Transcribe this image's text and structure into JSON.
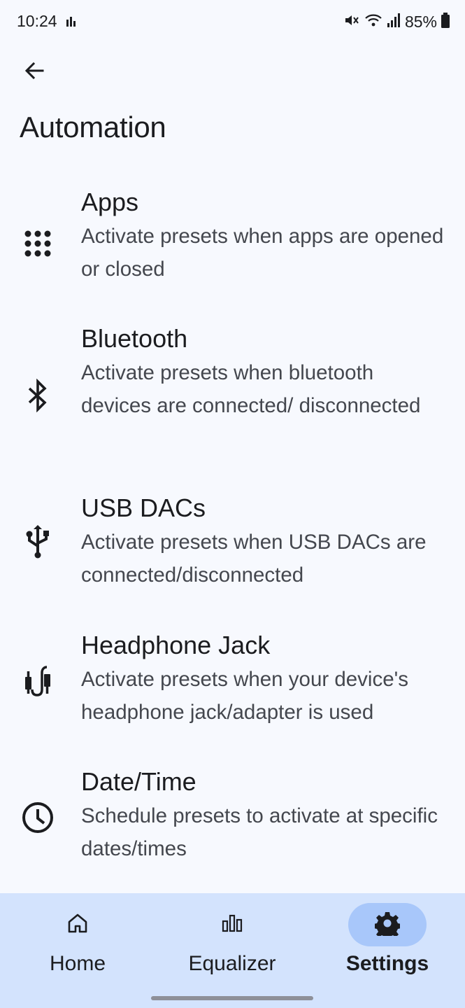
{
  "status_bar": {
    "time": "10:24",
    "battery_percent": "85%",
    "icons": [
      "activity-icon",
      "mute-icon",
      "wifi-icon",
      "signal-icon",
      "battery-icon"
    ]
  },
  "header": {
    "back_icon": "arrow-left-icon",
    "title": "Automation"
  },
  "items": [
    {
      "icon": "apps-grid-icon",
      "title": "Apps",
      "subtitle": "Activate presets when apps are opened or closed"
    },
    {
      "icon": "bluetooth-icon",
      "title": "Bluetooth",
      "subtitle": "Activate presets when bluetooth devices are connected/ disconnected"
    },
    {
      "icon": "usb-icon",
      "title": "USB DACs",
      "subtitle": "Activate presets when USB DACs are connected/disconnected"
    },
    {
      "icon": "headphone-jack-icon",
      "title": "Headphone Jack",
      "subtitle": "Activate presets when your device's headphone jack/adapter is used"
    },
    {
      "icon": "clock-icon",
      "title": "Date/Time",
      "subtitle": "Schedule presets to activate at specific dates/times"
    }
  ],
  "bottom_nav": {
    "items": [
      {
        "icon": "home-icon",
        "label": "Home",
        "active": false
      },
      {
        "icon": "equalizer-icon",
        "label": "Equalizer",
        "active": false
      },
      {
        "icon": "gear-icon",
        "label": "Settings",
        "active": true
      }
    ]
  },
  "colors": {
    "background": "#f7f9fe",
    "nav_background": "#d3e3fd",
    "active_pill": "#a8c7fa",
    "text_primary": "#1b1c1f",
    "text_secondary": "#44474e"
  }
}
